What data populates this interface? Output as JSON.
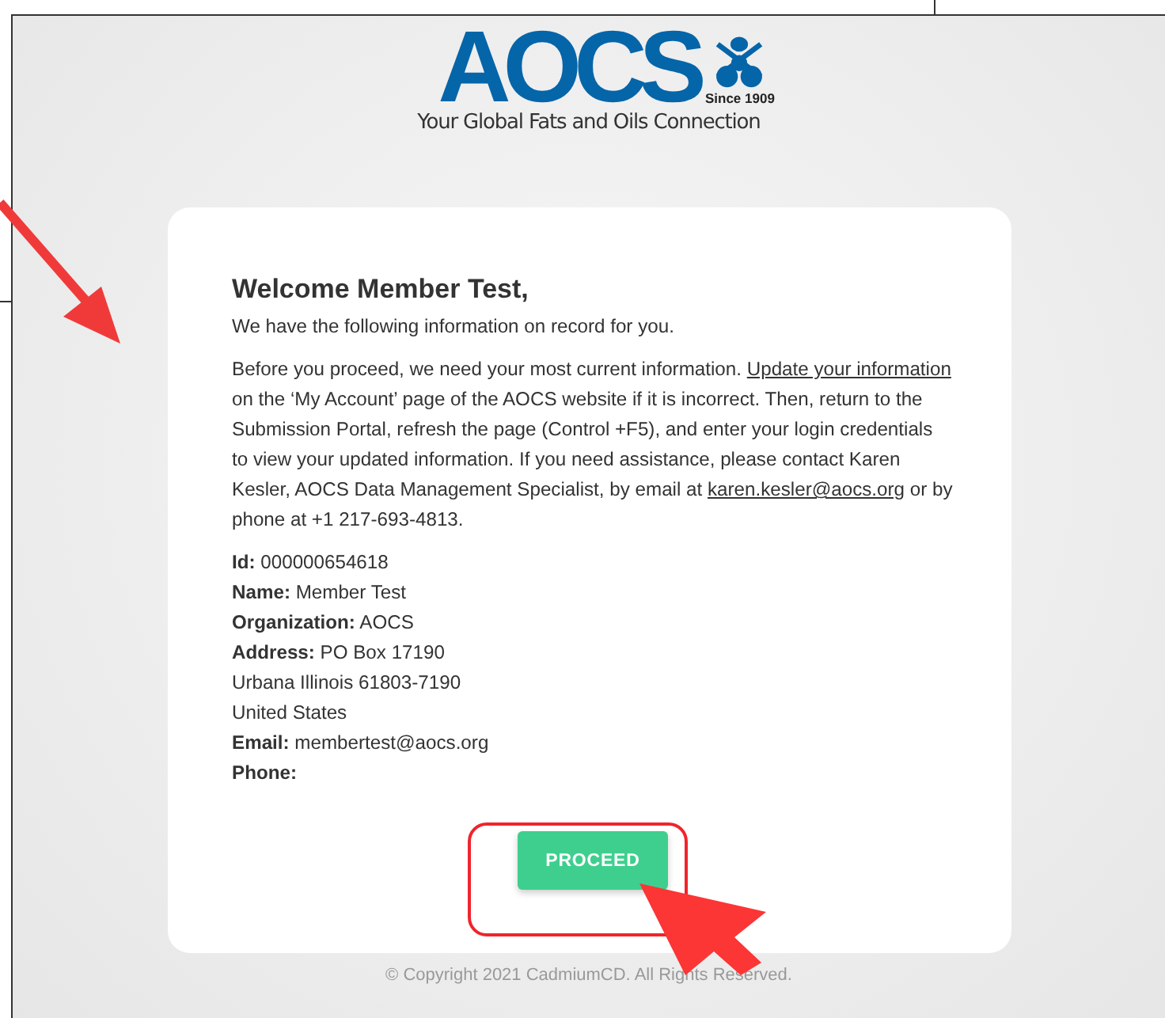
{
  "logo": {
    "wordmark": "AOCS",
    "since": "Since 1909",
    "tagline": "Your Global Fats and Oils Connection"
  },
  "card": {
    "heading": "Welcome Member Test,",
    "intro": "We have the following information on record for you.",
    "notice": [
      {
        "kind": "text",
        "text": "Before you proceed, we need your most current information. "
      },
      {
        "kind": "link",
        "text": "Update your information"
      },
      {
        "kind": "text",
        "text": " on the ‘My Account’ page of the AOCS website if it is incorrect. Then, return to the Submission Portal, refresh the page (Control +F5), and enter your login credentials to view your updated information. If you need assistance, please contact Karen Kesler, AOCS Data Management Specialist, by email at "
      },
      {
        "kind": "link",
        "text": "karen.kesler@aocs.org"
      },
      {
        "kind": "text",
        "text": " or by phone at +1 217-693-4813."
      }
    ],
    "details": [
      {
        "label": "Id:",
        "value": "000000654618"
      },
      {
        "label": "Name:",
        "value": "Member Test"
      },
      {
        "label": "Organization:",
        "value": "AOCS"
      },
      {
        "label": "Address:",
        "value": "PO Box 17190"
      },
      {
        "value": "Urbana Illinois 61803-7190"
      },
      {
        "value": "United States"
      },
      {
        "label": "Email:",
        "value": "membertest@aocs.org"
      },
      {
        "label": "Phone:"
      }
    ],
    "button": "PROCEED"
  },
  "footer": "© Copyright 2021 CadmiumCD. All Rights Reserved."
}
